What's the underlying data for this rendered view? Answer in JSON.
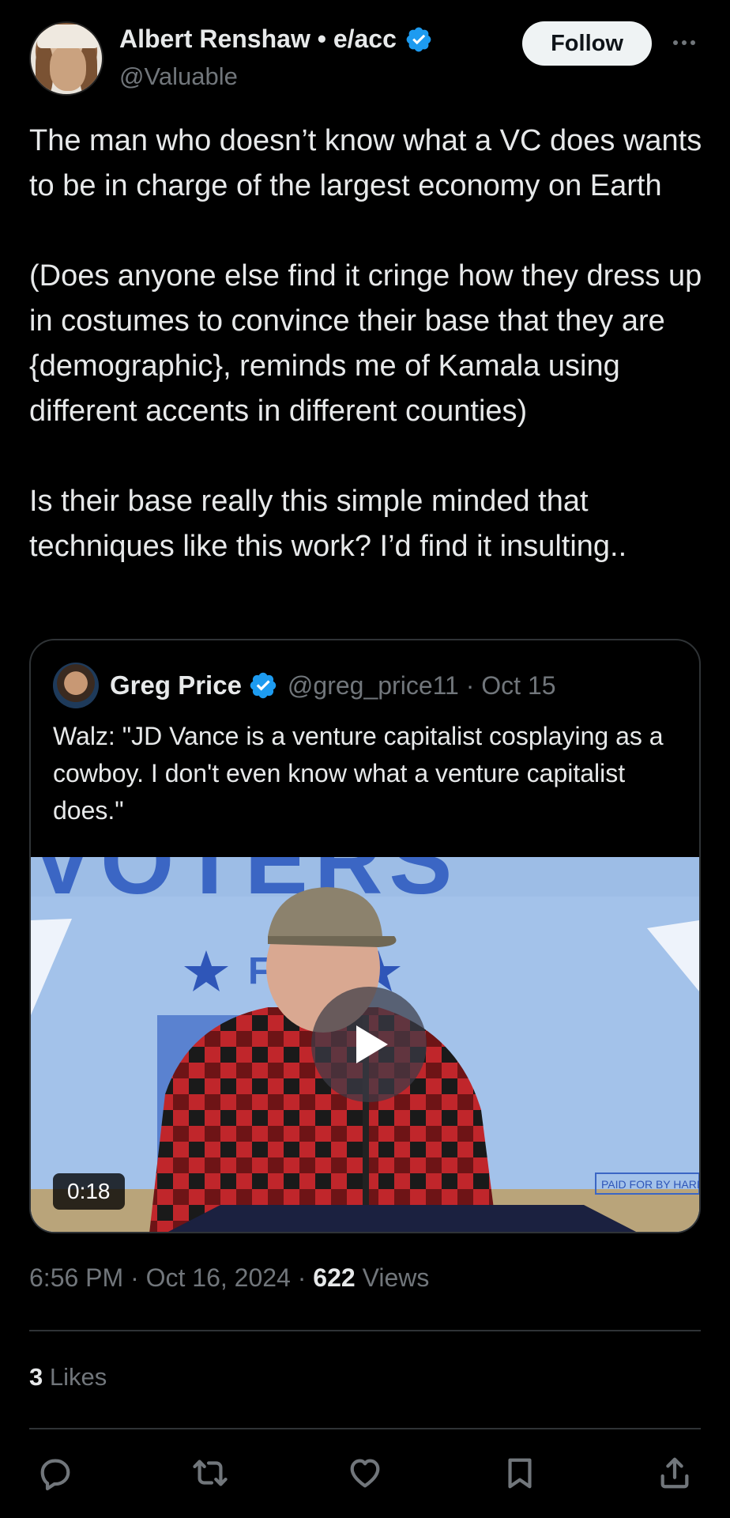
{
  "author": {
    "name": "Albert Renshaw • e/acc",
    "handle": "@Valuable",
    "verified": true,
    "avatar_icon": "user-avatar"
  },
  "follow_label": "Follow",
  "more_icon": "more-horizontal-icon",
  "tweet": {
    "paragraphs": [
      "The man who doesn’t know what a VC does wants to be in charge of the largest economy on Earth",
      "(Does anyone else find it cringe how they dress up in costumes to convince their base that they are {demographic}, reminds me of Kamala using different accents in different counties)",
      "Is their base really this simple minded that techniques like this work? I’d find it insulting.."
    ]
  },
  "quote": {
    "name": "Greg Price",
    "verified": true,
    "handle": "@greg_price11",
    "separator": "·",
    "date": "Oct 15",
    "text": "Walz: \"JD Vance is a venture capitalist cosplaying as a cowboy. I don't even know what a venture capitalist does.\"",
    "video": {
      "duration": "0:18",
      "banner_text": "VOTERS",
      "banner_sub": "F",
      "disclaimer": "PAID FOR BY HARRIS F"
    }
  },
  "meta": {
    "time": "6:56 PM",
    "separator": "·",
    "date": "Oct 16, 2024",
    "views_count": "622",
    "views_label": "Views"
  },
  "likes": {
    "count": "3",
    "label": "Likes"
  },
  "actions": [
    "reply-icon",
    "retweet-icon",
    "like-icon",
    "bookmark-icon",
    "share-icon"
  ],
  "colors": {
    "background": "#000000",
    "text": "#e7e9ea",
    "muted": "#71767b",
    "verified": "#1d9bf0",
    "divider": "#2f3336"
  }
}
